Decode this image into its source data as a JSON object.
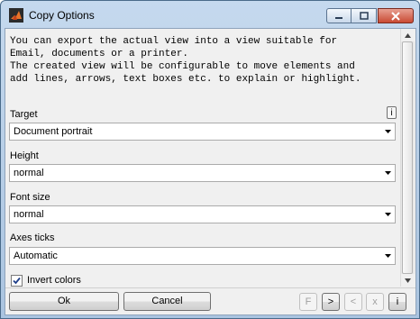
{
  "window": {
    "title": "Copy Options",
    "icon": "matlab-icon",
    "controls": {
      "minimize": "minimize-icon",
      "maximize": "maximize-icon",
      "close": "close-icon"
    }
  },
  "description": "You can export the actual view into a view suitable for\nEmail, documents or a printer.\nThe created view will be configurable to move elements and\nadd lines, arrows, text boxes etc. to explain or highlight.",
  "fields": {
    "target": {
      "label": "Target",
      "value": "Document portrait",
      "info": "i"
    },
    "height": {
      "label": "Height",
      "value": "normal"
    },
    "font_size": {
      "label": "Font size",
      "value": "normal"
    },
    "axes_ticks": {
      "label": "Axes ticks",
      "value": "Automatic"
    }
  },
  "invert_colors": {
    "label": "Invert colors",
    "checked": true
  },
  "buttons": {
    "ok": "Ok",
    "cancel": "Cancel",
    "f": "F",
    "next": ">",
    "prev": "<",
    "x": "x",
    "info": "i"
  }
}
